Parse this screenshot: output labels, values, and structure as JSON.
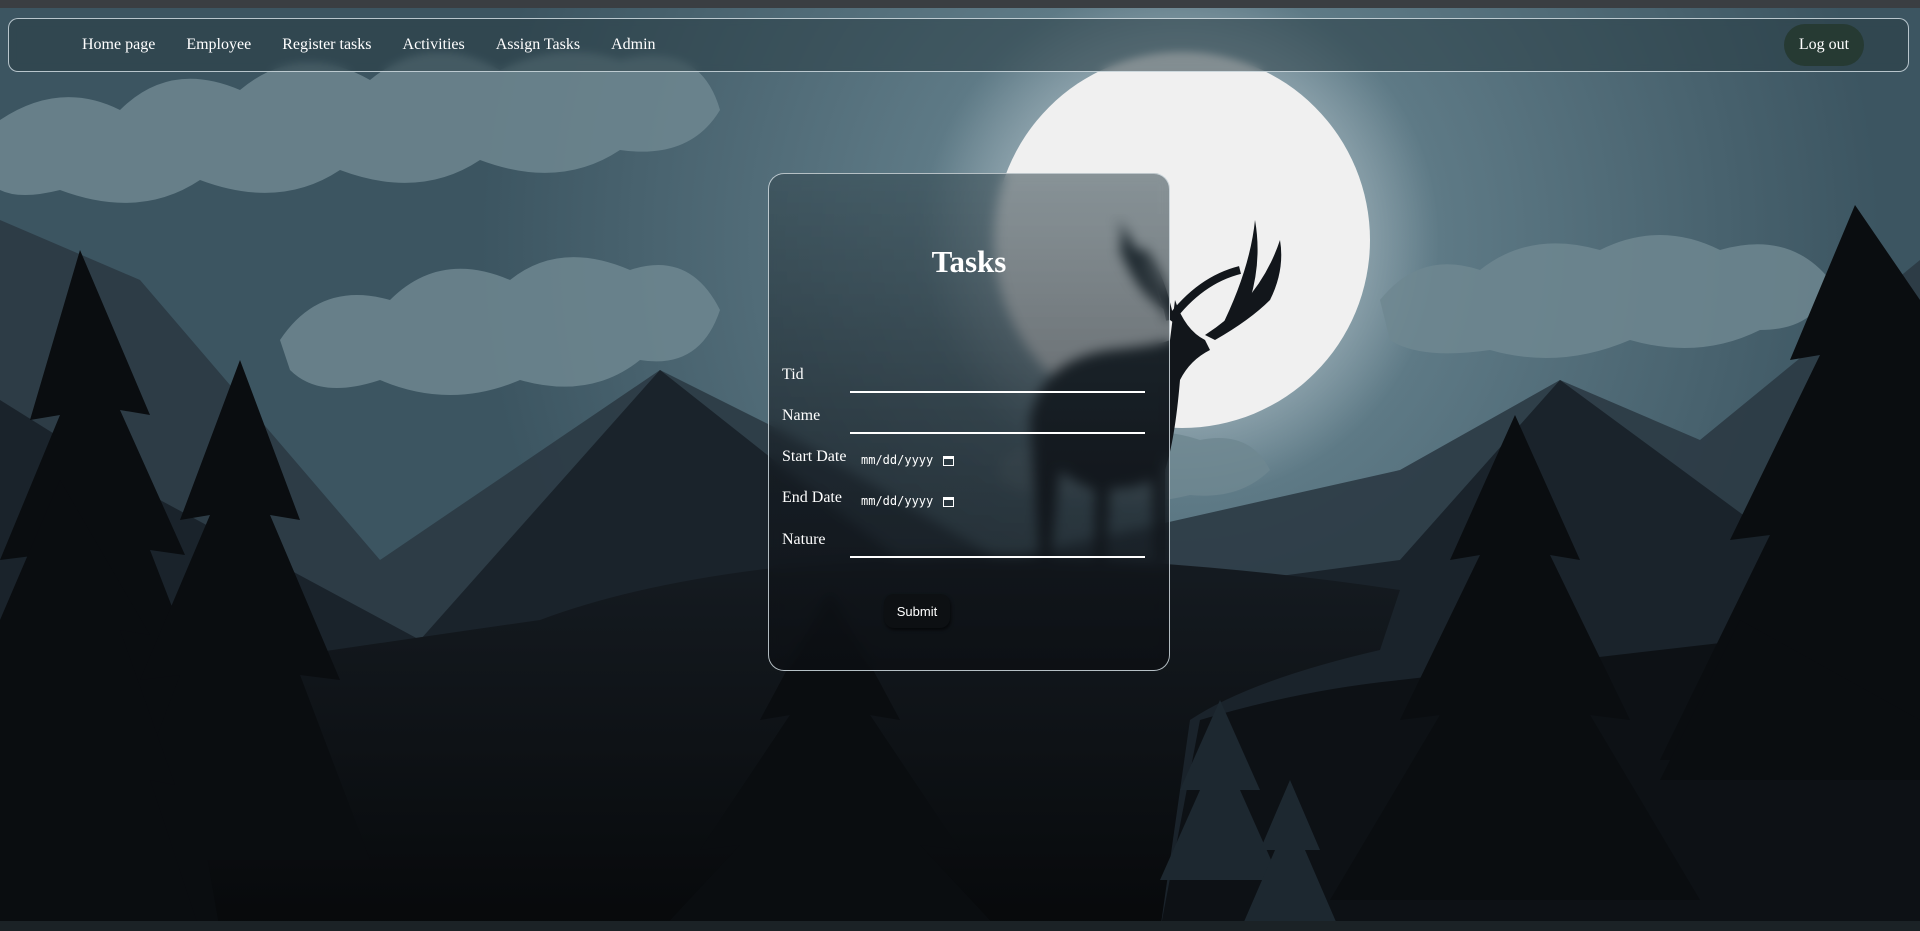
{
  "nav": {
    "links": [
      "Home page",
      "Employee",
      "Register tasks",
      "Activities",
      "Assign Tasks",
      "Admin"
    ],
    "logout_label": "Log out"
  },
  "form": {
    "title": "Tasks",
    "fields": {
      "tid": {
        "label": "Tid",
        "value": ""
      },
      "name": {
        "label": "Name",
        "value": ""
      },
      "start_date": {
        "label": "Start Date",
        "placeholder": "mm/dd/yyyy"
      },
      "end_date": {
        "label": "End Date",
        "placeholder": "mm/dd/yyyy"
      },
      "nature": {
        "label": "Nature",
        "value": ""
      }
    },
    "submit_label": "Submit"
  },
  "icons": {
    "calendar": "calendar-icon"
  },
  "colors": {
    "sky": "#4f6a76",
    "moon": "#f2f2f2",
    "card_border": "#dce6eb",
    "logout_bg": "#263a33",
    "text": "#ffffff"
  }
}
